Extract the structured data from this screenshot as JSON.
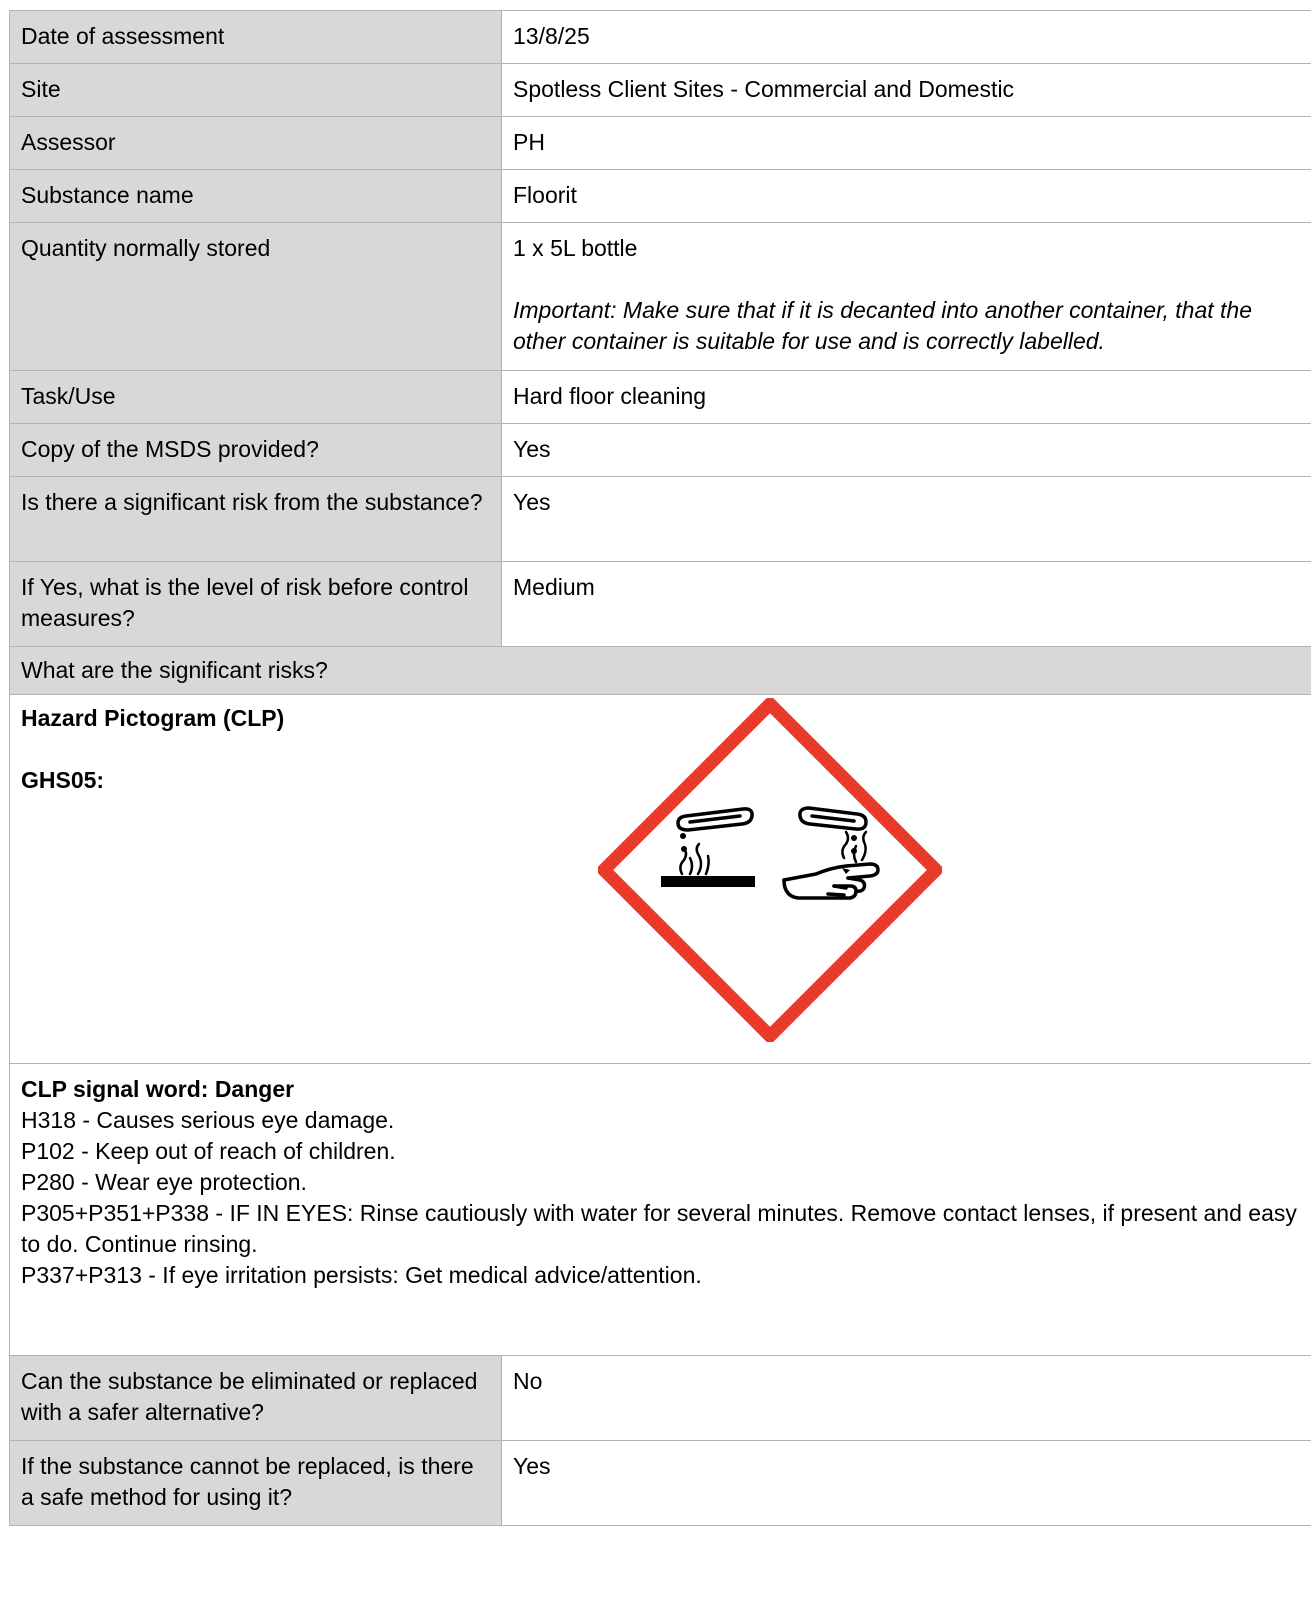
{
  "rows_top": [
    {
      "label": "Date of assessment",
      "value": "13/8/25"
    },
    {
      "label": "Site",
      "value": "Spotless Client Sites - Commercial and Domestic"
    },
    {
      "label": "Assessor",
      "value": "PH"
    },
    {
      "label": "Substance name",
      "value": "Floorit"
    }
  ],
  "quantity": {
    "label": "Quantity normally stored",
    "value": "1 x 5L bottle",
    "note": "Important: Make sure that if it is decanted into another container, that the other container is suitable for use and is correctly labelled."
  },
  "rows_mid": [
    {
      "label": "Task/Use",
      "value": "Hard floor cleaning"
    },
    {
      "label": "Copy of the MSDS provided?",
      "value": "Yes"
    },
    {
      "label": "Is there a significant risk from the substance?",
      "value": "Yes"
    },
    {
      "label": "If Yes, what is the level of risk before control measures?",
      "value": "Medium"
    }
  ],
  "risks_heading": "What are the significant risks?",
  "pictogram": {
    "title": "Hazard Pictogram (CLP)",
    "code": "GHS05:",
    "icon": "corrosion-icon",
    "colors": {
      "border": "#e8392b",
      "symbol": "#000000"
    }
  },
  "clp": {
    "signal_word": "CLP signal word: Danger",
    "statements": [
      "H318 - Causes serious eye damage.",
      "P102 - Keep out of reach of children.",
      "P280 - Wear eye protection.",
      "P305+P351+P338 - IF IN EYES: Rinse cautiously with water for several minutes. Remove contact lenses, if present and easy to do. Continue rinsing.",
      "P337+P313 - If eye irritation persists: Get medical advice/attention."
    ]
  },
  "rows_bottom": [
    {
      "label": "Can the substance be eliminated or replaced with a safer alternative?",
      "value": "No"
    },
    {
      "label": "If the substance cannot be replaced, is there a safe method for using it?",
      "value": "Yes"
    }
  ],
  "colors": {
    "label_bg": "#d8d8d8",
    "border": "#b3b3b3"
  }
}
